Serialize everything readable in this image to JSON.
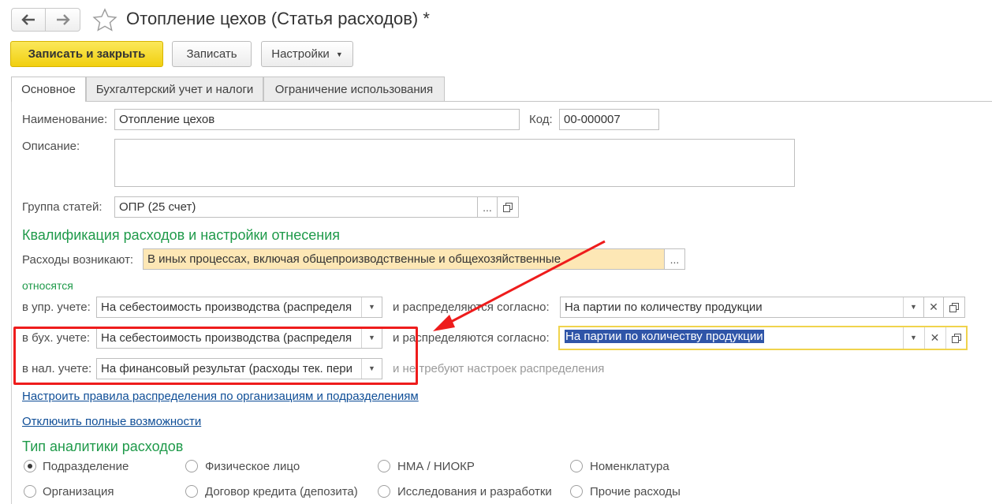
{
  "window": {
    "title": "Отопление цехов (Статья расходов) *",
    "back_icon": "arrow-left-icon",
    "forward_icon": "arrow-right-icon",
    "favorite_icon": "star-icon"
  },
  "toolbar": {
    "save_close": "Записать и закрыть",
    "save": "Записать",
    "settings": "Настройки"
  },
  "tabs": [
    "Основное",
    "Бухгалтерский учет и налоги",
    "Ограничение использования"
  ],
  "form": {
    "name_label": "Наименование:",
    "name_value": "Отопление цехов",
    "code_label": "Код:",
    "code_value": "00-000007",
    "description_label": "Описание:",
    "description_value": "",
    "group_label": "Группа статей:",
    "group_value": "ОПР (25 счет)",
    "ellipsis": "..."
  },
  "qualification": {
    "section_title": "Квалификация расходов и настройки отнесения",
    "arise_label": "Расходы возникают:",
    "arise_value": "В иных процессах, включая общепроизводственные и общехозяйственные",
    "relate_label": "относятся",
    "rows": [
      {
        "label": "в упр. учете:",
        "value": "На себестоимость производства (распределя",
        "dist_label": "и распределяются согласно:",
        "dist_value": "На партии по количеству продукции"
      },
      {
        "label": "в бух. учете:",
        "value": "На себестоимость производства (распределя",
        "dist_label": "и распределяются согласно:",
        "dist_value": "На партии по количеству продукции"
      },
      {
        "label": "в нал. учете:",
        "value": "На финансовый результат (расходы тек. пери",
        "dist_label": "и не требуют настроек распределения"
      }
    ],
    "link_rules": "Настроить правила распределения по организациям и подразделениям",
    "link_disable": "Отключить полные возможности"
  },
  "analytics": {
    "section_title": "Тип аналитики расходов",
    "options": [
      {
        "label": "Подразделение",
        "selected": true
      },
      {
        "label": "Физическое лицо",
        "selected": false
      },
      {
        "label": "НМА / НИОКР",
        "selected": false
      },
      {
        "label": "Номенклатура",
        "selected": false
      },
      {
        "label": "Организация",
        "selected": false
      },
      {
        "label": "Договор кредита (депозита)",
        "selected": false
      },
      {
        "label": "Исследования и разработки",
        "selected": false
      },
      {
        "label": "Прочие расходы",
        "selected": false
      }
    ]
  },
  "annotation": {
    "box_color": "#ee1c1c",
    "arrow_color": "#ee1c1c"
  },
  "colors": {
    "primary_button": "#f1cf0f",
    "section_green": "#1f9a4a",
    "link_blue": "#0f4e97",
    "selection_blue": "#2f55a8"
  }
}
